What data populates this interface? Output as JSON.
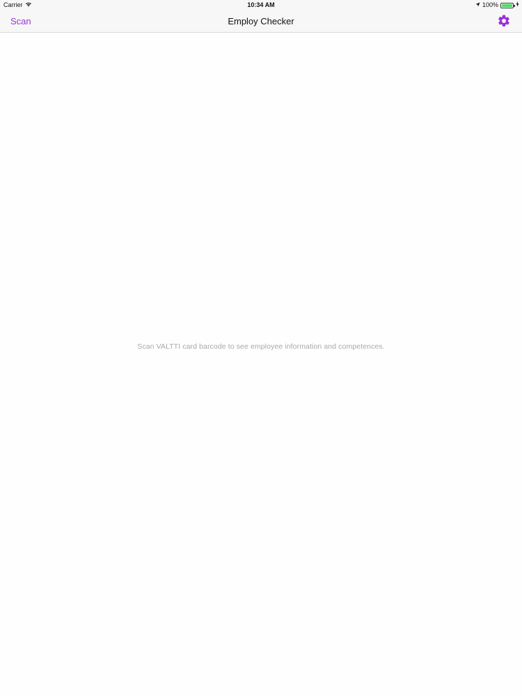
{
  "status_bar": {
    "carrier": "Carrier",
    "time": "10:34 AM",
    "battery_percent": "100%",
    "battery_level": 1.0,
    "icons": [
      "wifi-icon",
      "location-arrow-icon",
      "battery-icon",
      "charging-icon"
    ]
  },
  "nav": {
    "left_label": "Scan",
    "title": "Employ Checker",
    "right_icon": "gear-icon"
  },
  "content": {
    "empty_message": "Scan VALTTI card barcode to see employee information and competences."
  },
  "colors": {
    "accent": "#9b30d9",
    "nav_background": "#f7f7f7",
    "message_text": "#a8a8a8",
    "battery_fill": "#4cd964"
  }
}
